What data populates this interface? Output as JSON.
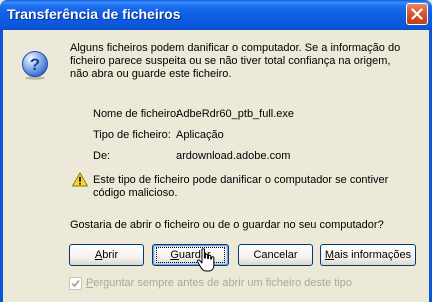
{
  "window": {
    "title": "Transferência de ficheiros"
  },
  "message": {
    "line1": "Alguns ficheiros podem danificar o computador. Se a informação do",
    "line2": "ficheiro parece suspeita ou se não tiver total confiança na origem,",
    "line3": "não abra ou guarde este ficheiro."
  },
  "file_info": {
    "name_label": "Nome de ficheiro:",
    "name_value": "AdbeRdr60_ptb_full.exe",
    "type_label": "Tipo de ficheiro:",
    "type_value": "Aplicação",
    "from_label": "De:",
    "from_value": "ardownload.adobe.com"
  },
  "warning": {
    "line1": "Este tipo de ficheiro pode danificar o computador se contiver",
    "line2": "código malicioso."
  },
  "question": "Gostaria de abrir o ficheiro ou de o guardar no seu computador?",
  "buttons": {
    "open_mnemonic": "A",
    "open_rest": "brir",
    "save_mnemonic": "G",
    "save_rest": "uardar",
    "cancel": "Cancelar",
    "more_mnemonic": "M",
    "more_rest": "ais informações"
  },
  "checkbox": {
    "mnemonic": "P",
    "label_rest": "erguntar sempre antes de abrir um ficheiro deste tipo",
    "checked": true,
    "disabled": true
  },
  "colors": {
    "titlebar": "#0b5ee6",
    "dialog_bg": "#ece9d8",
    "close_button": "#d8562f",
    "button_border": "#003c74",
    "disabled_text": "#aca899"
  },
  "icons": [
    "question-icon",
    "warning-icon",
    "close-icon",
    "check-icon",
    "cursor-icon"
  ]
}
